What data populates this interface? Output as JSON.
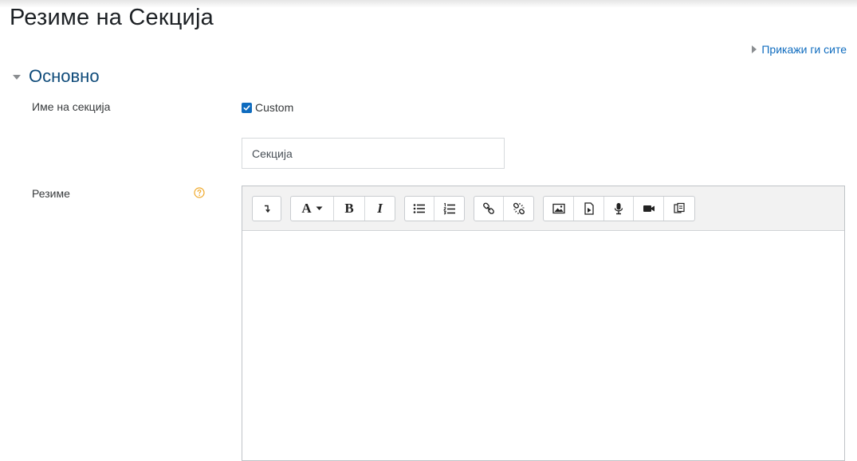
{
  "page": {
    "title": "Резиме на Секција",
    "expand_all": "Прикажи ги сите"
  },
  "section": {
    "legend": "Основно"
  },
  "fields": {
    "name_label": "Име на секција",
    "custom_label": "Custom",
    "custom_checked": true,
    "name_value": "Секција",
    "summary_label": "Резиме"
  },
  "toolbar": {
    "groups": [
      [
        "toggle-toolbar-icon"
      ],
      [
        "font-style-icon",
        "bold-icon",
        "italic-icon"
      ],
      [
        "unordered-list-icon",
        "ordered-list-icon"
      ],
      [
        "link-icon",
        "unlink-icon"
      ],
      [
        "image-icon",
        "media-icon",
        "record-audio-icon",
        "record-video-icon",
        "manage-files-icon"
      ]
    ],
    "bold_label": "B",
    "italic_label": "I",
    "font_label": "A"
  },
  "colors": {
    "accent": "#0f6cbf",
    "legend": "#0f4b7a",
    "help": "#f0a92a"
  }
}
